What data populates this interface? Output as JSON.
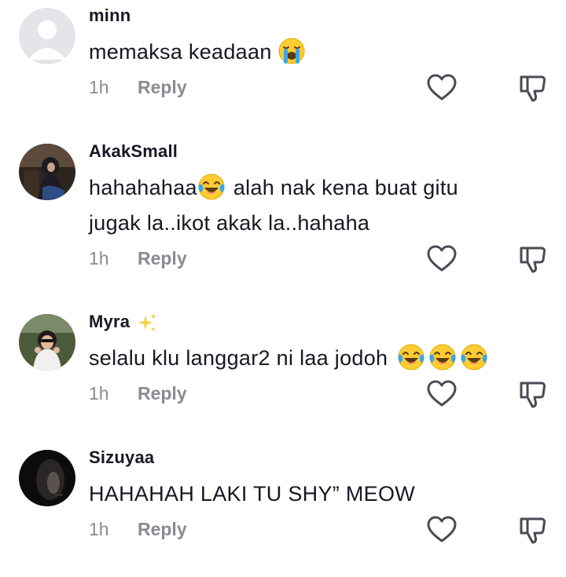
{
  "comments": [
    {
      "username": "minn",
      "text_lines": [
        "memaksa keadaan"
      ],
      "emoji": "loudly-crying-face",
      "time": "1h",
      "reply_label": "Reply",
      "avatar": "default-avatar"
    },
    {
      "username": "AkakSmall",
      "text_lines": [
        "hahahahaa",
        "alah nak kena buat gitu",
        "jugak la..ikot akak la..hahaha"
      ],
      "emoji": "face-with-tears-of-joy",
      "time": "1h",
      "reply_label": "Reply",
      "avatar": "photo-avatar-woman-hijab"
    },
    {
      "username": "Myra",
      "username_badge": "sparkles-icon",
      "text_lines": [
        "selalu klu langgar2 ni laa jodoh"
      ],
      "emoji": "face-with-tears-of-joy",
      "emoji_count": 3,
      "time": "1h",
      "reply_label": "Reply",
      "avatar": "photo-avatar-woman-sunglasses"
    },
    {
      "username": "Sizuyaa",
      "text_lines": [
        "HAHAHAH LAKI TU SHY” MEOW"
      ],
      "time": "1h",
      "reply_label": "Reply",
      "avatar": "photo-avatar-dark"
    }
  ],
  "icons": {
    "like": "heart-outline-icon",
    "dislike": "thumbs-down-outline-icon"
  },
  "colors": {
    "text": "#161823",
    "meta": "#8a8b91",
    "icon_stroke": "#4a4b55",
    "emoji_yellow": "#ffcc33",
    "emoji_tear": "#3aa6e8"
  }
}
